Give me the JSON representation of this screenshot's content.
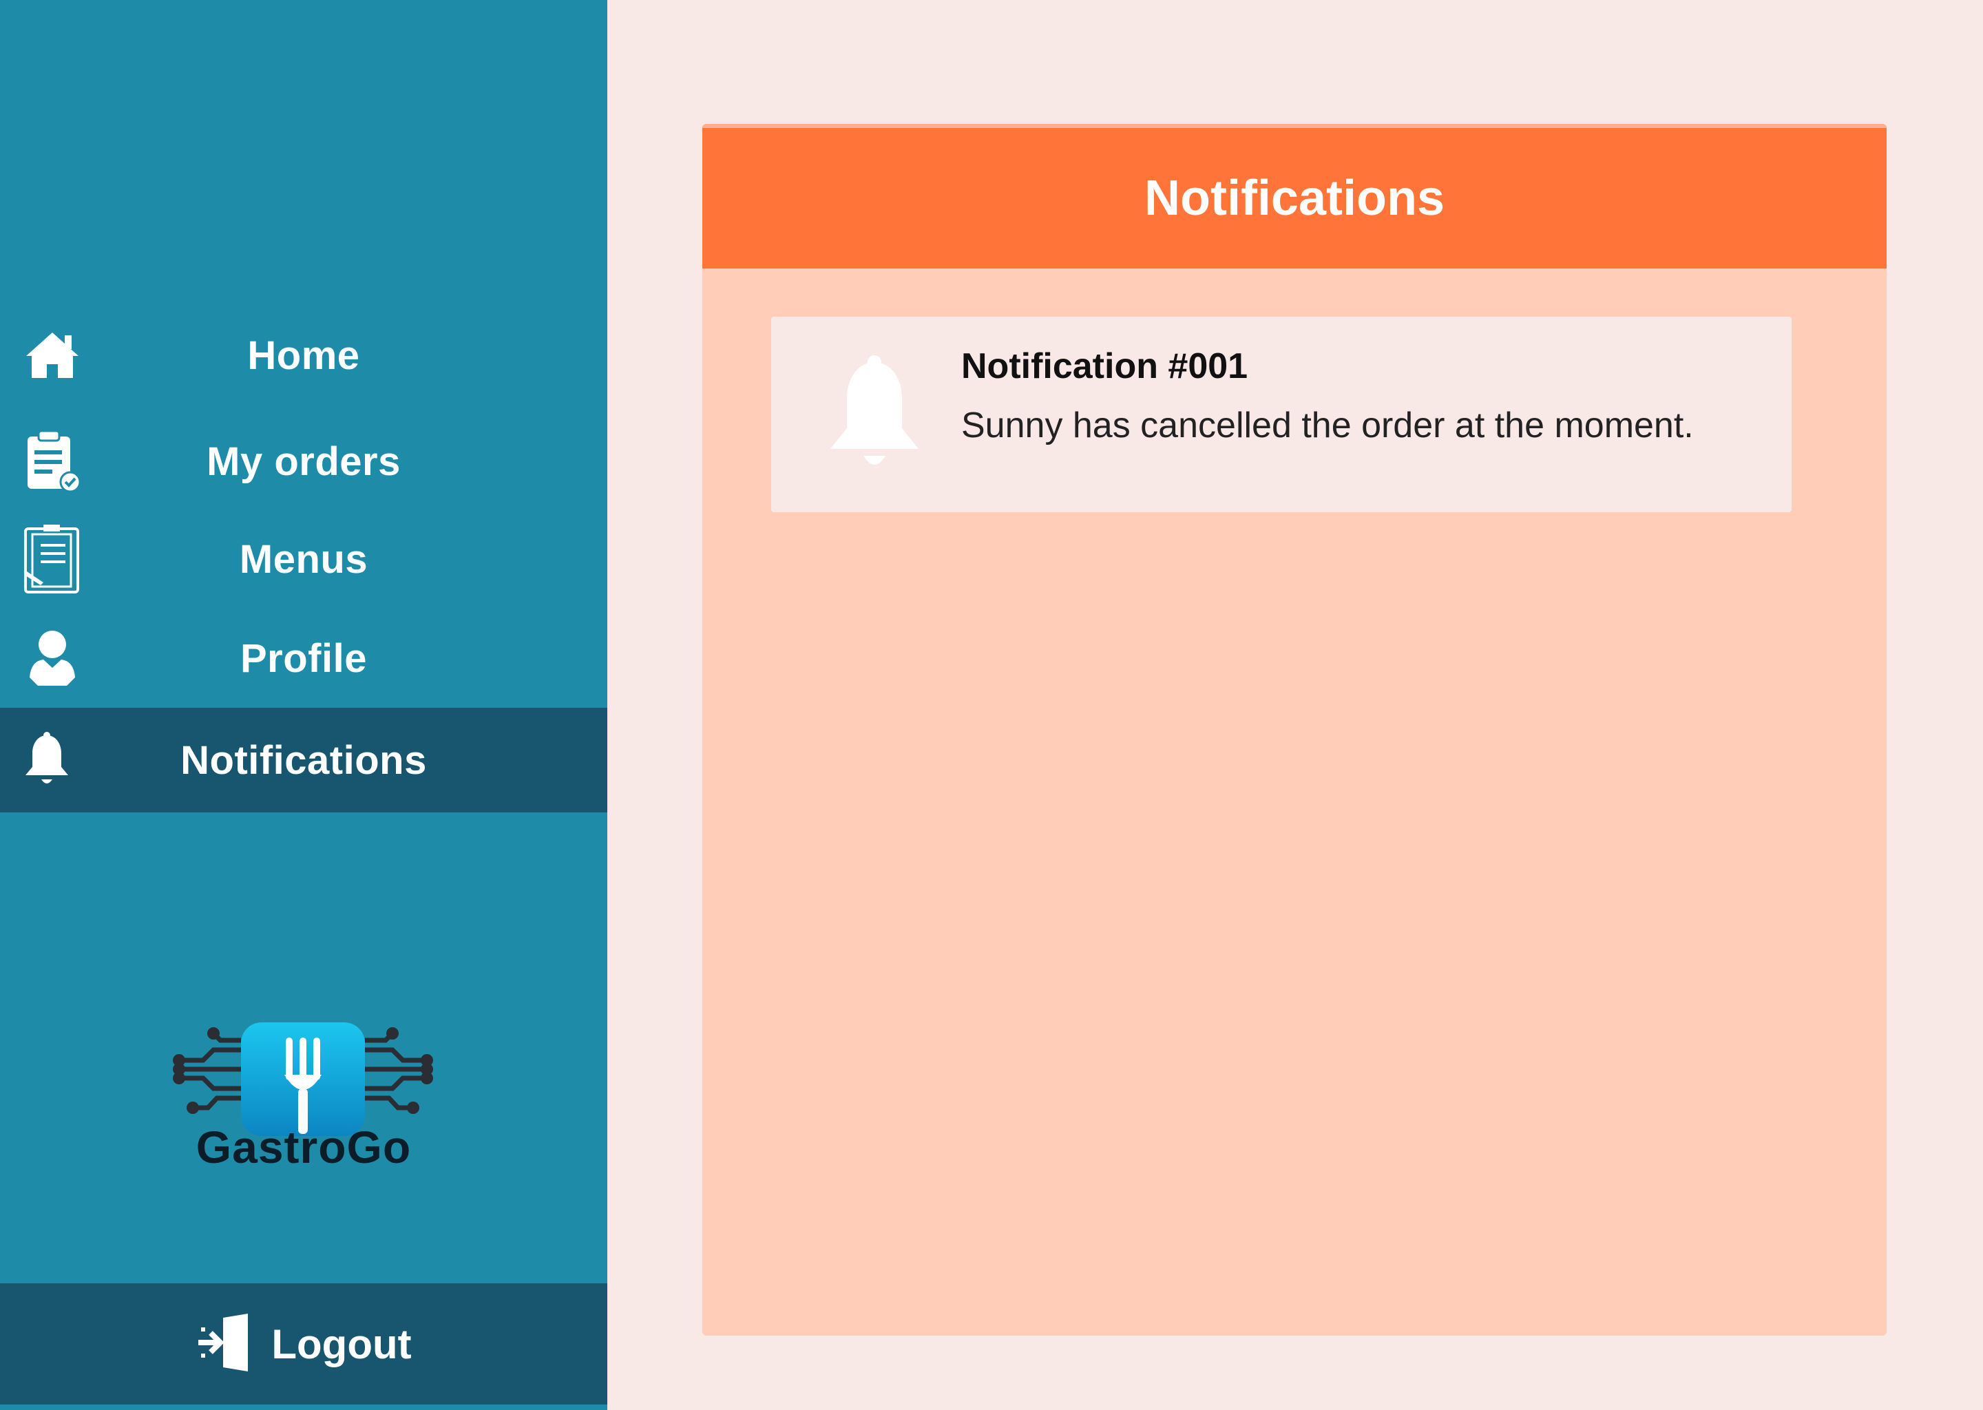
{
  "sidebar": {
    "items": [
      {
        "label": "Home",
        "icon": "home-icon"
      },
      {
        "label": "My orders",
        "icon": "clipboard-check-icon"
      },
      {
        "label": "Menus",
        "icon": "menu-list-icon"
      },
      {
        "label": "Profile",
        "icon": "user-icon"
      },
      {
        "label": "Notifications",
        "icon": "bell-icon",
        "active": true
      }
    ],
    "brand": "GastroGo",
    "logout_label": "Logout"
  },
  "main": {
    "title": "Notifications",
    "notifications": [
      {
        "title": "Notification #001",
        "message": "Sunny has cancelled the order at the moment."
      }
    ]
  },
  "colors": {
    "sidebar": "#1e8ca8",
    "sidebar_active": "#18566f",
    "header": "#ff7438",
    "panel": "#ffcdb8",
    "background": "#f9e9e6"
  }
}
